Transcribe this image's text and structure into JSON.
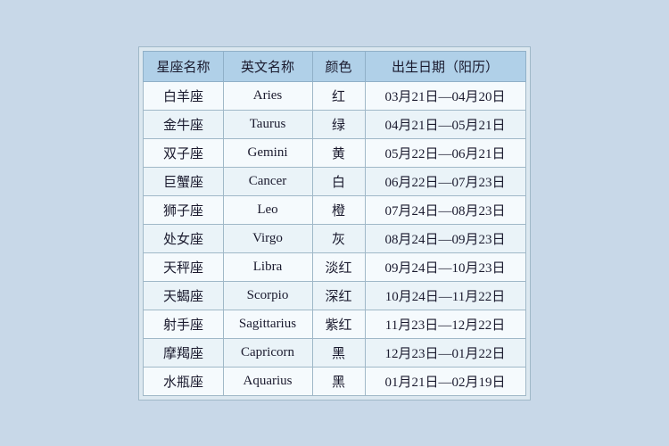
{
  "table": {
    "headers": [
      {
        "key": "chinese_name",
        "label": "星座名称"
      },
      {
        "key": "english_name",
        "label": "英文名称"
      },
      {
        "key": "color",
        "label": "颜色"
      },
      {
        "key": "date_range",
        "label": "出生日期（阳历）"
      }
    ],
    "rows": [
      {
        "chinese_name": "白羊座",
        "english_name": "Aries",
        "color": "红",
        "date_range": "03月21日—04月20日"
      },
      {
        "chinese_name": "金牛座",
        "english_name": "Taurus",
        "color": "绿",
        "date_range": "04月21日—05月21日"
      },
      {
        "chinese_name": "双子座",
        "english_name": "Gemini",
        "color": "黄",
        "date_range": "05月22日—06月21日"
      },
      {
        "chinese_name": "巨蟹座",
        "english_name": "Cancer",
        "color": "白",
        "date_range": "06月22日—07月23日"
      },
      {
        "chinese_name": "狮子座",
        "english_name": "Leo",
        "color": "橙",
        "date_range": "07月24日—08月23日"
      },
      {
        "chinese_name": "处女座",
        "english_name": "Virgo",
        "color": "灰",
        "date_range": "08月24日—09月23日"
      },
      {
        "chinese_name": "天秤座",
        "english_name": "Libra",
        "color": "淡红",
        "date_range": "09月24日—10月23日"
      },
      {
        "chinese_name": "天蝎座",
        "english_name": "Scorpio",
        "color": "深红",
        "date_range": "10月24日—11月22日"
      },
      {
        "chinese_name": "射手座",
        "english_name": "Sagittarius",
        "color": "紫红",
        "date_range": "11月23日—12月22日"
      },
      {
        "chinese_name": "摩羯座",
        "english_name": "Capricorn",
        "color": "黑",
        "date_range": "12月23日—01月22日"
      },
      {
        "chinese_name": "水瓶座",
        "english_name": "Aquarius",
        "color": "黑",
        "date_range": "01月21日—02月19日"
      }
    ]
  }
}
